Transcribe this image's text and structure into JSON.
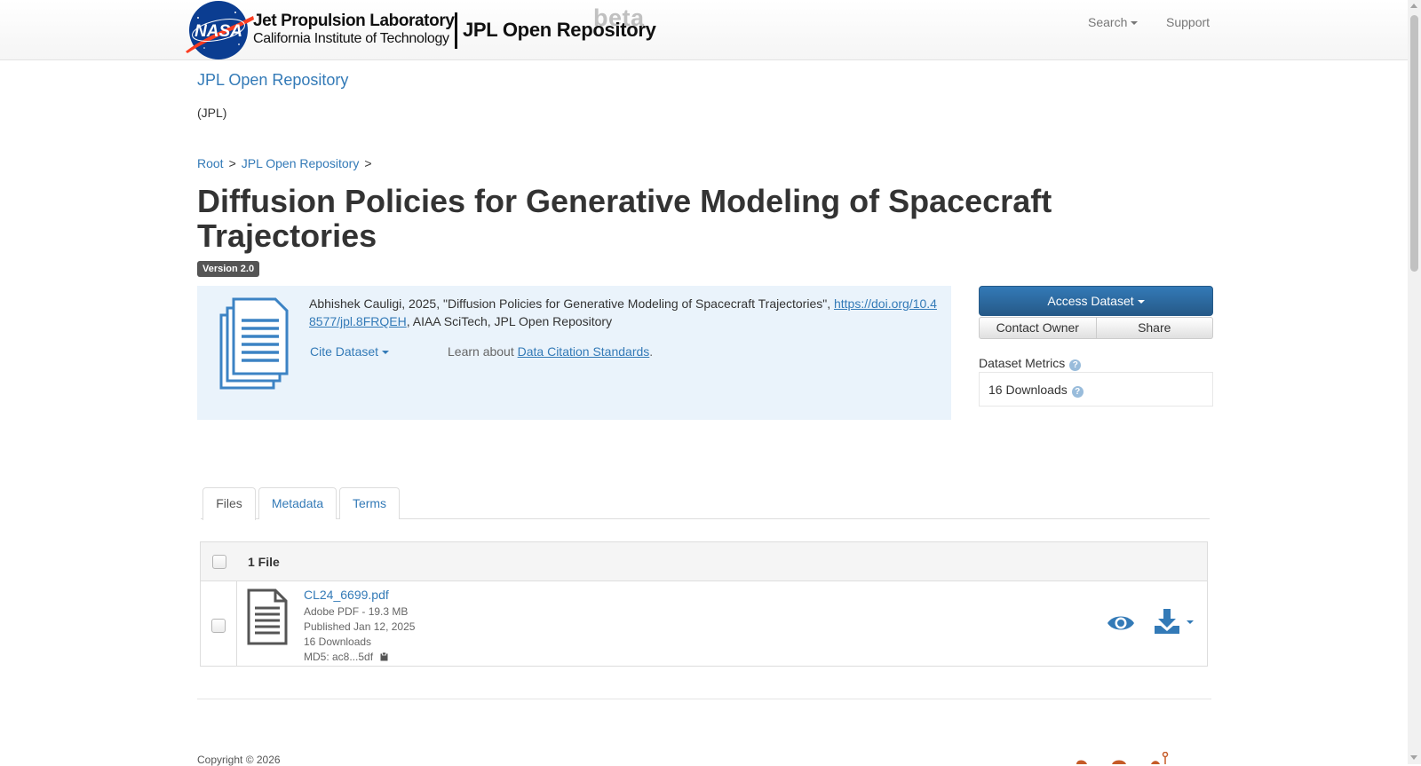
{
  "navbar": {
    "org_name": "Jet Propulsion Laboratory",
    "org_subtitle": "California Institute of Technology",
    "repo_name": "JPL Open Repository",
    "beta_label": "beta",
    "logo_text": "NASA",
    "search_label": "Search",
    "support_label": "Support"
  },
  "dataverse": {
    "title": "JPL Open Repository",
    "affiliation": "(JPL)"
  },
  "breadcrumb": {
    "items": [
      "Root",
      "JPL Open Repository"
    ],
    "separator": ">"
  },
  "dataset": {
    "title": "Diffusion Policies for Generative Modeling of Spacecraft Trajectories",
    "version": "Version 2.0",
    "citation_prefix": "Abhishek Cauligi, 2025, \"Diffusion Policies for Generative Modeling of Spacecraft Trajectories\", ",
    "citation_doi": "https://doi.org/10.48577/jpl.8FRQEH",
    "citation_suffix": ", AIAA SciTech, JPL Open Repository",
    "cite_label": "Cite Dataset",
    "learn_prefix": "Learn about ",
    "learn_link": "Data Citation Standards",
    "learn_suffix": "."
  },
  "sidebar": {
    "access_label": "Access Dataset",
    "contact_label": "Contact Owner",
    "share_label": "Share",
    "metrics_label": "Dataset Metrics",
    "downloads": "16 Downloads"
  },
  "tabs": [
    {
      "label": "Files",
      "active": true
    },
    {
      "label": "Metadata",
      "active": false
    },
    {
      "label": "Terms",
      "active": false
    }
  ],
  "files": {
    "count_label": "1 File",
    "rows": [
      {
        "name": "CL24_6699.pdf",
        "type_size": "Adobe PDF - 19.3 MB",
        "published": "Published Jan 12, 2025",
        "downloads": "16 Downloads",
        "md5": "MD5: ac8...5df"
      }
    ]
  },
  "footer": {
    "copyright": "Copyright © 2026"
  },
  "icons": {
    "dataset": "dataset-document-stack-icon",
    "file": "file-document-icon",
    "preview": "eye-icon",
    "download": "download-icon",
    "copy": "clipboard-icon",
    "help": "question-circle-icon"
  },
  "colors": {
    "link": "#337ab7",
    "primary_button": "#286090",
    "citation_bg": "#eaf3fb",
    "nasa_blue": "#0b3d91",
    "nasa_red": "#fc3d21"
  }
}
